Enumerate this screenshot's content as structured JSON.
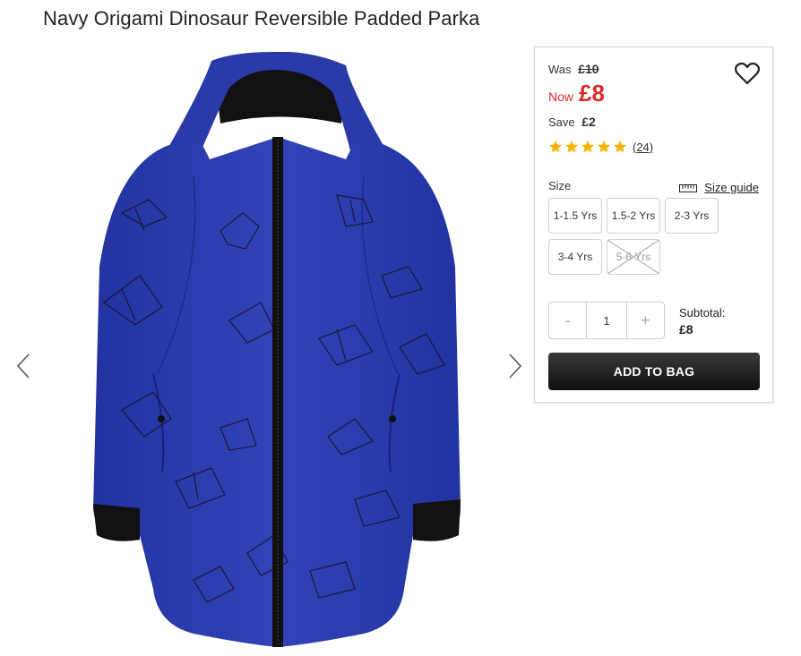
{
  "product": {
    "title": "Navy Origami Dinosaur Reversible Padded Parka"
  },
  "pricing": {
    "was_label": "Was",
    "was_price": "£10",
    "now_label": "Now",
    "now_price": "£8",
    "save_label": "Save",
    "save_amount": "£2"
  },
  "rating": {
    "stars": 5,
    "review_count": "(24)",
    "star_color": "#f5b301"
  },
  "size": {
    "label": "Size",
    "guide_label": "Size guide",
    "options": [
      {
        "label": "1-1.5 Yrs",
        "available": true
      },
      {
        "label": "1.5-2 Yrs",
        "available": true
      },
      {
        "label": "2-3 Yrs",
        "available": true
      },
      {
        "label": "3-4 Yrs",
        "available": true
      },
      {
        "label": "5-6 Yrs",
        "available": false
      }
    ]
  },
  "quantity": {
    "minus": "-",
    "value": "1",
    "plus": "+"
  },
  "subtotal": {
    "label": "Subtotal:",
    "amount": "£8"
  },
  "cta": {
    "add_to_bag": "ADD TO BAG"
  },
  "colors": {
    "sale_red": "#d52b2b",
    "jacket_blue": "#2a3aa8",
    "button_dark": "#1e1e1e"
  },
  "icons": {
    "wishlist": "heart-icon",
    "size_guide": "ruler-icon",
    "prev": "chevron-left-icon",
    "next": "chevron-right-icon"
  }
}
